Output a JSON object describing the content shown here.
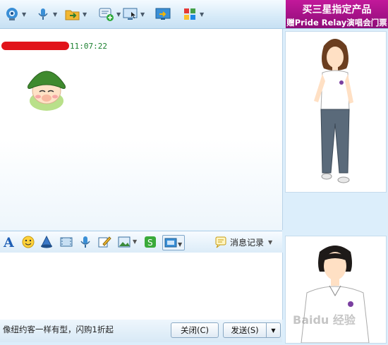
{
  "ad_banner": {
    "line1": "买三星指定产品",
    "line2": "赠Pride Relay演唱会门票"
  },
  "toolbar": {
    "icons": [
      "webcam-icon",
      "microphone-icon",
      "file-transfer-icon",
      "add-chat-icon",
      "remote-assist-icon",
      "screen-share-icon",
      "apps-grid-icon"
    ]
  },
  "chat": {
    "message_time": "11:07:22",
    "emoticon": "soldier-helmet-emoticon"
  },
  "input_toolbar": {
    "icons": [
      "font-icon",
      "smiley-icon",
      "shake-icon",
      "video-clip-icon",
      "voice-icon",
      "edit-icon",
      "image-icon",
      "music-icon",
      "screenshot-icon"
    ],
    "history_label": "消息记录"
  },
  "bottom": {
    "ad_text": "像纽约客一样有型，闪购1折起",
    "close_label": "关闭(C)",
    "send_label": "发送(S)"
  },
  "watermark": "Baidu 经验"
}
